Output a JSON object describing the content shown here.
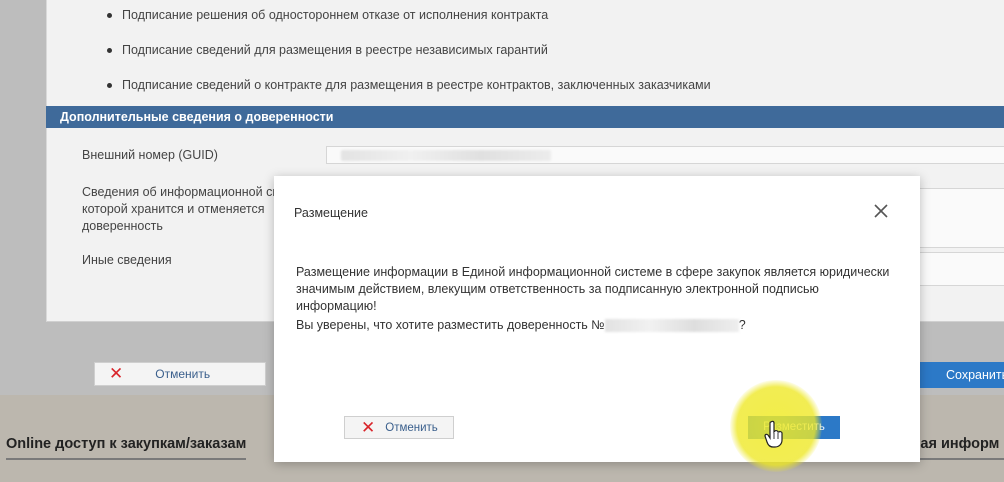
{
  "background": {
    "bullets": [
      "Подписание решения об одностороннем отказе от исполнения контракта",
      "Подписание сведений для размещения в реестре независимых гарантий",
      "Подписание сведений о контракте для размещения в реестре контрактов, заключенных заказчиками"
    ],
    "section_title": "Дополнительные сведения о доверенности",
    "fields": {
      "guid_label": "Внешний номер (GUID)",
      "info_system_label_1": "Сведения об информационной сис",
      "info_system_label_2": "которой хранится и отменяется",
      "info_system_label_3": "доверенность",
      "other_label": "Иные сведения"
    },
    "cancel_label": "Отменить",
    "save_label": "Сохранить",
    "footer_left": "Online доступ к закупкам/заказам",
    "footer_right": "чая информ"
  },
  "modal": {
    "title": "Размещение",
    "message": "Размещение информации в Единой информационной системе в сфере закупок является юридически значимым действием, влекущим ответственность за подписанную электронной подписью информацию!",
    "question_prefix": "Вы уверены, что хотите разместить доверенность №",
    "question_suffix": "?",
    "cancel_label": "Отменить",
    "publish_label": "Разместить"
  },
  "colors": {
    "section_bar": "#3f6a9a",
    "primary_button": "#2c79c7",
    "cancel_icon": "#d9252b",
    "highlight": "#f0eb28"
  }
}
